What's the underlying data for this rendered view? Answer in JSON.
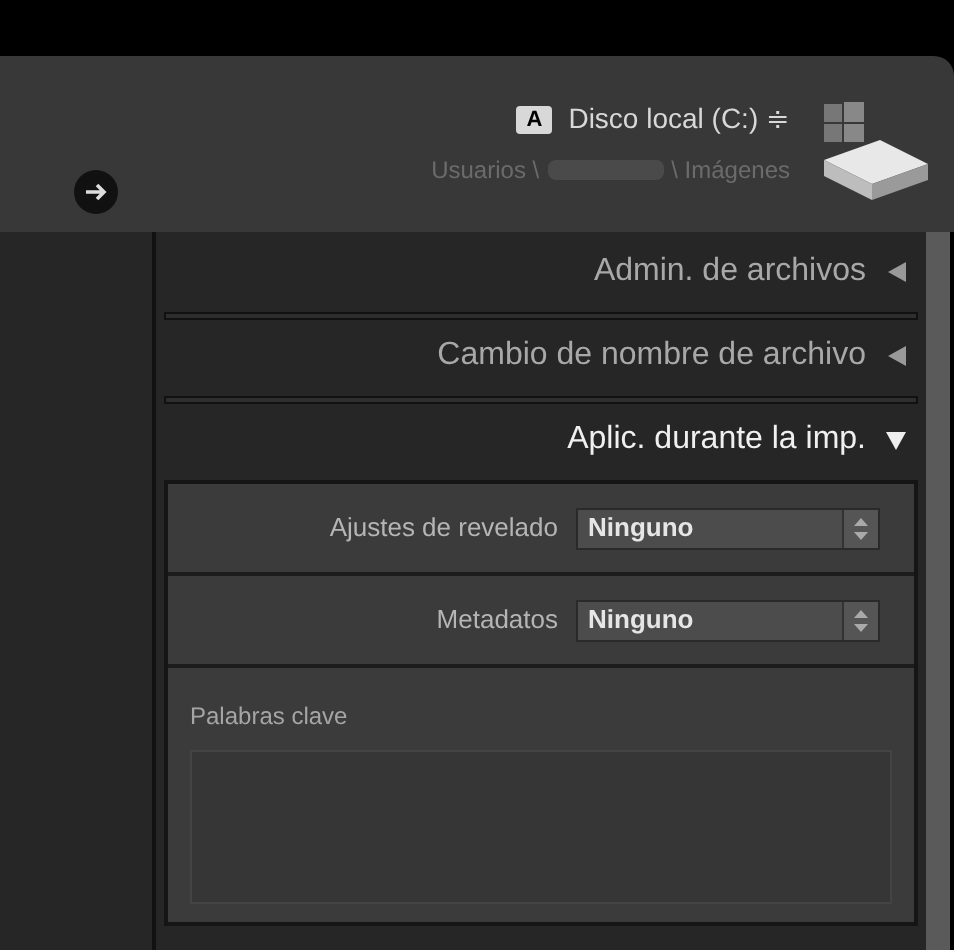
{
  "header": {
    "drive_badge": "A",
    "drive": "Disco local (C:)",
    "drive_stepper": "≑",
    "path_start": "Usuarios \\",
    "path_end": "\\ Imágenes"
  },
  "sections": [
    {
      "title": "Admin. de archivos",
      "expanded": false
    },
    {
      "title": "Cambio de nombre de archivo",
      "expanded": false
    },
    {
      "title": "Aplic. durante la imp.",
      "expanded": true,
      "settings": [
        {
          "kind": "select",
          "label": "Ajustes de revelado",
          "value": "Ninguno"
        },
        {
          "kind": "select",
          "label": "Metadatos",
          "value": "Ninguno"
        },
        {
          "kind": "textarea",
          "label": "Palabras clave"
        }
      ]
    }
  ]
}
